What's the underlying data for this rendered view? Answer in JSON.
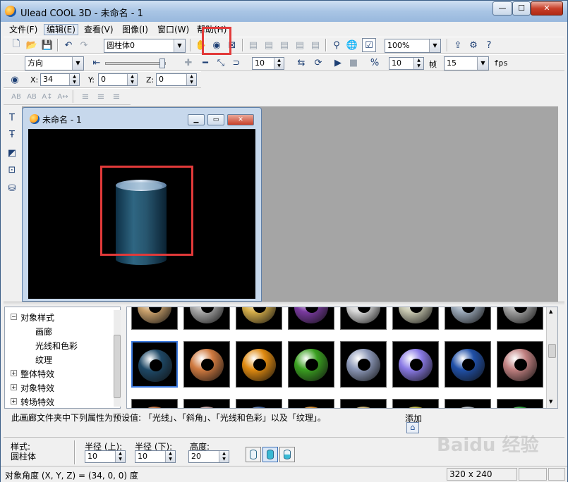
{
  "window": {
    "title": "Ulead COOL 3D - 未命名 - 1",
    "min": "—",
    "max": "☐",
    "close": "✕"
  },
  "menu": [
    "文件(F)",
    "编辑(E)",
    "查看(V)",
    "图像(I)",
    "窗口(W)",
    "帮助(H)"
  ],
  "toolbar1": {
    "object_combo": "圆柱体0",
    "zoom_combo": "100%"
  },
  "toolbar2": {
    "mode_combo": "方向",
    "frame_value": "10",
    "frames_value": "10",
    "frames_label": "帧",
    "fps_value": "15",
    "fps_label": "fps"
  },
  "toolbar3": {
    "x_label": "X:",
    "x_value": "34",
    "y_label": "Y:",
    "y_value": "0",
    "z_label": "Z:",
    "z_value": "0"
  },
  "document": {
    "title": "未命名 - 1"
  },
  "tree": {
    "items": [
      "对象样式",
      "画廊",
      "光线和色彩",
      "纹理",
      "整体特效",
      "对象特效",
      "转场特效"
    ]
  },
  "gallery": {
    "colors": {
      "row1": [
        "#c9a06b",
        "#a8a8a8",
        "#d8b04a",
        "#7a3aa0",
        "#d8d8d8",
        "#c8c8b0",
        "#9aa8b8",
        "#a0a0a0"
      ],
      "row2": [
        "#1e4866",
        "#d07a40",
        "#e08a10",
        "#3aa020",
        "#8c98b8",
        "#8a7ae6",
        "#2050a8",
        "#c08080"
      ],
      "row3": [
        "#c07040",
        "#c0a0a0",
        "#4a6aa0",
        "#d08a30",
        "#c8b070",
        "#b8b040",
        "#b0b8c0",
        "#30a040"
      ]
    }
  },
  "description": "此画廊文件夹中下列属性为预设值: 「光线」、「斜角」、「光线和色彩」以及「纹理」。",
  "add": {
    "label": "添加"
  },
  "properties": {
    "style_label": "样式:",
    "style_value": "圆柱体",
    "radius_top_label": "半径 (上):",
    "radius_top_value": "10",
    "radius_bottom_label": "半径 (下):",
    "radius_bottom_value": "10",
    "height_label": "高度:",
    "height_value": "20"
  },
  "status": {
    "angle_text": "对象角度 (X, Y, Z) = (34, 0, 0) 度",
    "size_text": "320 x 240"
  },
  "watermark": "Baidu 经验"
}
